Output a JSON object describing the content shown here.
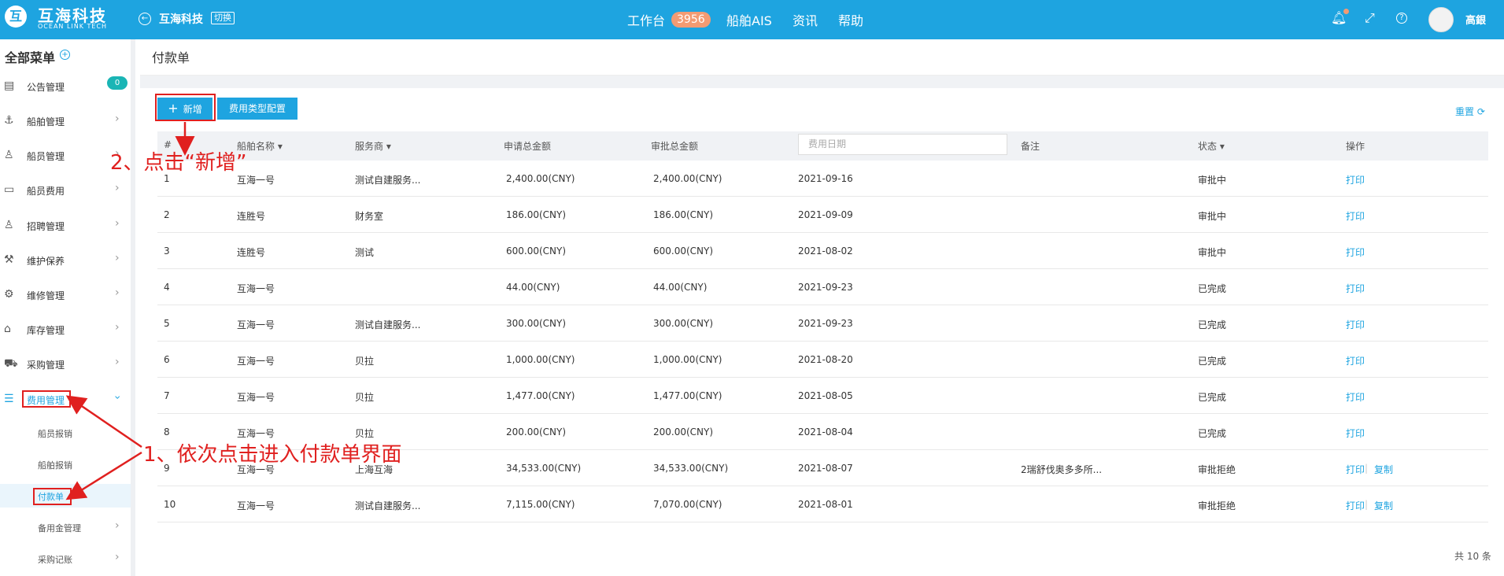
{
  "header": {
    "logo_mark": "互",
    "brand": "互海科技",
    "brand_en": "OCEAN LINK TECH",
    "company": "互海科技",
    "switch_label": "切换",
    "nav": [
      {
        "label": "工作台",
        "badge": "3956"
      },
      {
        "label": "船舶AIS"
      },
      {
        "label": "资讯"
      },
      {
        "label": "帮助"
      }
    ],
    "user": "高銀"
  },
  "sidebar": {
    "title": "全部菜单",
    "notice_count": "0",
    "items": [
      {
        "label": "公告管理",
        "icon": "book-icon"
      },
      {
        "label": "船舶管理",
        "icon": "anchor-icon"
      },
      {
        "label": "船员管理",
        "icon": "person-icon"
      },
      {
        "label": "船员费用",
        "icon": "wallet-icon"
      },
      {
        "label": "招聘管理",
        "icon": "recruit-icon"
      },
      {
        "label": "维护保养",
        "icon": "tool-icon"
      },
      {
        "label": "维修管理",
        "icon": "wrench-icon"
      },
      {
        "label": "库存管理",
        "icon": "warehouse-icon"
      },
      {
        "label": "采购管理",
        "icon": "cart-icon"
      },
      {
        "label": "费用管理",
        "icon": "database-icon"
      }
    ],
    "sub_items": [
      {
        "label": "船员报销"
      },
      {
        "label": "船舶报销"
      },
      {
        "label": "付款单"
      },
      {
        "label": "备用金管理"
      },
      {
        "label": "采购记账"
      }
    ]
  },
  "page": {
    "title": "付款单",
    "add_button": "新增",
    "config_button": "费用类型配置",
    "reset": "重置"
  },
  "table": {
    "headers": [
      "#",
      "船舶名称",
      "服务商",
      "申请总金额",
      "审批总金额",
      "费用日期",
      "备注",
      "状态",
      "操作"
    ],
    "date_placeholder": "费用日期",
    "rows": [
      {
        "no": "1",
        "ship": "互海一号",
        "vendor": "测试自建服务...",
        "apply": "2,400.00(CNY)",
        "approve": "2,400.00(CNY)",
        "date": "2021-09-16",
        "note": "",
        "status": "审批中",
        "actions": [
          "打印"
        ]
      },
      {
        "no": "2",
        "ship": "连胜号",
        "vendor": "财务室",
        "apply": "186.00(CNY)",
        "approve": "186.00(CNY)",
        "date": "2021-09-09",
        "note": "",
        "status": "审批中",
        "actions": [
          "打印"
        ]
      },
      {
        "no": "3",
        "ship": "连胜号",
        "vendor": "测试",
        "apply": "600.00(CNY)",
        "approve": "600.00(CNY)",
        "date": "2021-08-02",
        "note": "",
        "status": "审批中",
        "actions": [
          "打印"
        ]
      },
      {
        "no": "4",
        "ship": "互海一号",
        "vendor": "",
        "apply": "44.00(CNY)",
        "approve": "44.00(CNY)",
        "date": "2021-09-23",
        "note": "",
        "status": "已完成",
        "actions": [
          "打印"
        ]
      },
      {
        "no": "5",
        "ship": "互海一号",
        "vendor": "测试自建服务...",
        "apply": "300.00(CNY)",
        "approve": "300.00(CNY)",
        "date": "2021-09-23",
        "note": "",
        "status": "已完成",
        "actions": [
          "打印"
        ]
      },
      {
        "no": "6",
        "ship": "互海一号",
        "vendor": "贝拉",
        "apply": "1,000.00(CNY)",
        "approve": "1,000.00(CNY)",
        "date": "2021-08-20",
        "note": "",
        "status": "已完成",
        "actions": [
          "打印"
        ]
      },
      {
        "no": "7",
        "ship": "互海一号",
        "vendor": "贝拉",
        "apply": "1,477.00(CNY)",
        "approve": "1,477.00(CNY)",
        "date": "2021-08-05",
        "note": "",
        "status": "已完成",
        "actions": [
          "打印"
        ]
      },
      {
        "no": "8",
        "ship": "互海一号",
        "vendor": "贝拉",
        "apply": "200.00(CNY)",
        "approve": "200.00(CNY)",
        "date": "2021-08-04",
        "note": "",
        "status": "已完成",
        "actions": [
          "打印"
        ]
      },
      {
        "no": "9",
        "ship": "互海一号",
        "vendor": "上海互海",
        "apply": "34,533.00(CNY)",
        "approve": "34,533.00(CNY)",
        "date": "2021-08-07",
        "note": "2瑞舒伐奥多多所...",
        "status": "审批拒绝",
        "actions": [
          "打印",
          "复制"
        ]
      },
      {
        "no": "10",
        "ship": "互海一号",
        "vendor": "测试自建服务...",
        "apply": "7,115.00(CNY)",
        "approve": "7,070.00(CNY)",
        "date": "2021-08-01",
        "note": "",
        "status": "审批拒绝",
        "actions": [
          "打印",
          "复制"
        ]
      }
    ],
    "total": "共 10 条"
  },
  "annotations": {
    "step1": "1、依次点击进入付款单界面",
    "step2": "2、点击“新增”"
  },
  "colors": {
    "primary": "#1ea4e0",
    "annotation": "#e0201f",
    "badge": "#f39b73"
  }
}
